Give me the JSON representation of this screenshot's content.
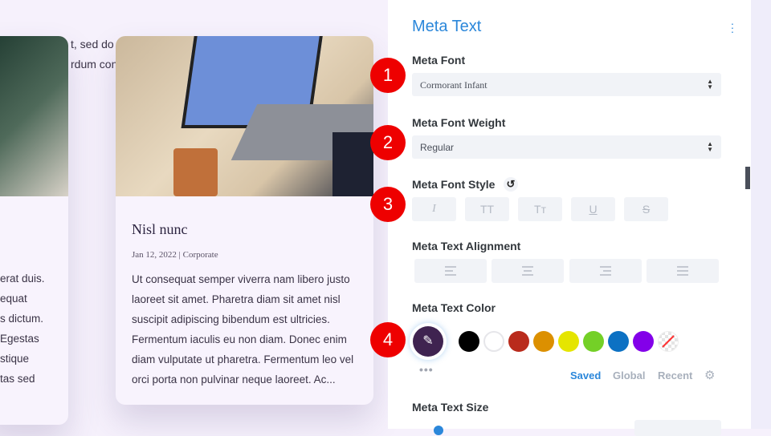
{
  "background": {
    "text_lines": [
      "t, sed do e",
      "rdum cons"
    ],
    "left_card_lines": [
      "erat duis.",
      "equat",
      "s dictum.",
      "Egestas",
      "stique",
      "tas sed"
    ]
  },
  "card": {
    "title": "Nisl nunc",
    "meta": "Jan 12, 2022 | Corporate",
    "excerpt_lines": [
      "Ut consequat semper viverra nam libero justo",
      "laoreet sit amet. Pharetra diam sit amet nisl",
      "suscipit adipiscing bibendum est ultricies.",
      "Fermentum iaculis eu non diam. Donec enim",
      "diam vulputate ut pharetra. Fermentum leo vel",
      "orci porta non pulvinar neque laoreet. Ac..."
    ]
  },
  "panel": {
    "title": "Meta Text",
    "font_label": "Meta Font",
    "font_value": "Cormorant Infant",
    "weight_label": "Meta Font Weight",
    "weight_value": "Regular",
    "style_label": "Meta Font Style",
    "style_buttons": [
      "I",
      "TT",
      "Tт",
      "U",
      "S"
    ],
    "alignment_label": "Meta Text Alignment",
    "color_label": "Meta Text Color",
    "current_color": "#3f2350",
    "swatches": [
      "#000000",
      "#ffffff",
      "#b92b1c",
      "#dc9000",
      "#e5e500",
      "#74d027",
      "#0c71c3",
      "#8300e9",
      "transparent"
    ],
    "color_tabs": [
      "Saved",
      "Global",
      "Recent"
    ],
    "size_label": "Meta Text Size",
    "accent": "#2b87da"
  },
  "badges": [
    "1",
    "2",
    "3",
    "4"
  ]
}
